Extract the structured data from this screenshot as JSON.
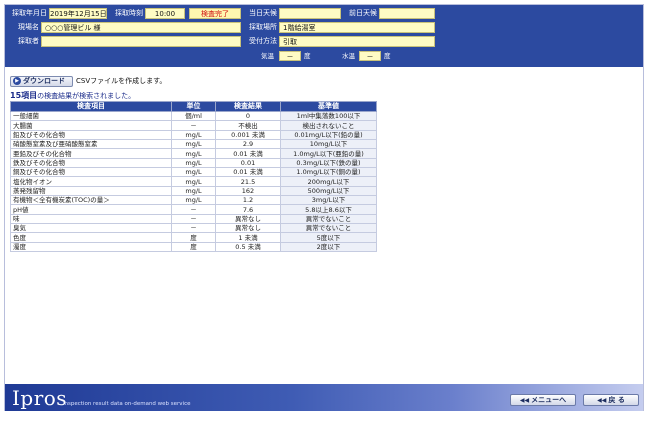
{
  "header": {
    "date_label": "採取年月日",
    "date_value": "2019年12月15日",
    "time_label": "採取時刻",
    "time_value": "10:00",
    "status_badge": "検査完了",
    "site_label": "現場名",
    "site_value": "○○○管理ビル 様",
    "collector_label": "採取者",
    "collector_value": "",
    "weather_today_label": "当日天候",
    "weather_today_value": "",
    "weather_prev_label": "前日天候",
    "weather_prev_value": "",
    "location_label": "採取場所",
    "location_value": "1階給湯室",
    "delivery_label": "受付方法",
    "delivery_value": "引取",
    "air_temp_label": "気温",
    "air_temp_value": "－",
    "water_temp_label": "水温",
    "water_temp_value": "－",
    "degree_unit": "度"
  },
  "toolbar": {
    "download_label": "ダウンロード",
    "download_icon": "play-circle-icon",
    "download_message": "CSVファイルを作成します。"
  },
  "result": {
    "count_label": "15項目",
    "message": "の検査結果が検索されました。"
  },
  "table": {
    "headers": [
      "検査項目",
      "単位",
      "検査結果",
      "基準値"
    ],
    "rows": [
      [
        "一般細菌",
        "個/ml",
        "0",
        "1ml中集落数100以下"
      ],
      [
        "大腸菌",
        "－",
        "不検出",
        "検出されないこと"
      ],
      [
        "鉛及びその化合物",
        "mg/L",
        "0.001 未満",
        "0.01mg/L以下(鉛の量)"
      ],
      [
        "硝酸態窒素及び亜硝酸態窒素",
        "mg/L",
        "2.9",
        "10mg/L以下"
      ],
      [
        "亜鉛及びその化合物",
        "mg/L",
        "0.01 未満",
        "1.0mg/L以下(亜鉛の量)"
      ],
      [
        "鉄及びその化合物",
        "mg/L",
        "0.01",
        "0.3mg/L以下(鉄の量)"
      ],
      [
        "銅及びその化合物",
        "mg/L",
        "0.01 未満",
        "1.0mg/L以下(銅の量)"
      ],
      [
        "塩化物イオン",
        "mg/L",
        "21.5",
        "200mg/L以下"
      ],
      [
        "蒸発残留物",
        "mg/L",
        "162",
        "500mg/L以下"
      ],
      [
        "有機物＜全有機炭素(TOC)の量＞",
        "mg/L",
        "1.2",
        "3mg/L以下"
      ],
      [
        "pH値",
        "－",
        "7.6",
        "5.8以上8.6以下"
      ],
      [
        "味",
        "－",
        "異常なし",
        "異常でないこと"
      ],
      [
        "臭気",
        "－",
        "異常なし",
        "異常でないこと"
      ],
      [
        "色度",
        "度",
        "1 未満",
        "5度以下"
      ],
      [
        "濁度",
        "度",
        "0.5 未満",
        "2度以下"
      ]
    ]
  },
  "footer": {
    "logo": "Ipros",
    "tagline": "inspection result data on-demand web service",
    "menu_button": "メニューへ",
    "back_button": "戻 る"
  },
  "colors": {
    "header_bg": "#2c4aa0",
    "field_bg": "#fffcc4",
    "badge_text": "#d01010",
    "table_header_bg": "#2c4aa0"
  }
}
